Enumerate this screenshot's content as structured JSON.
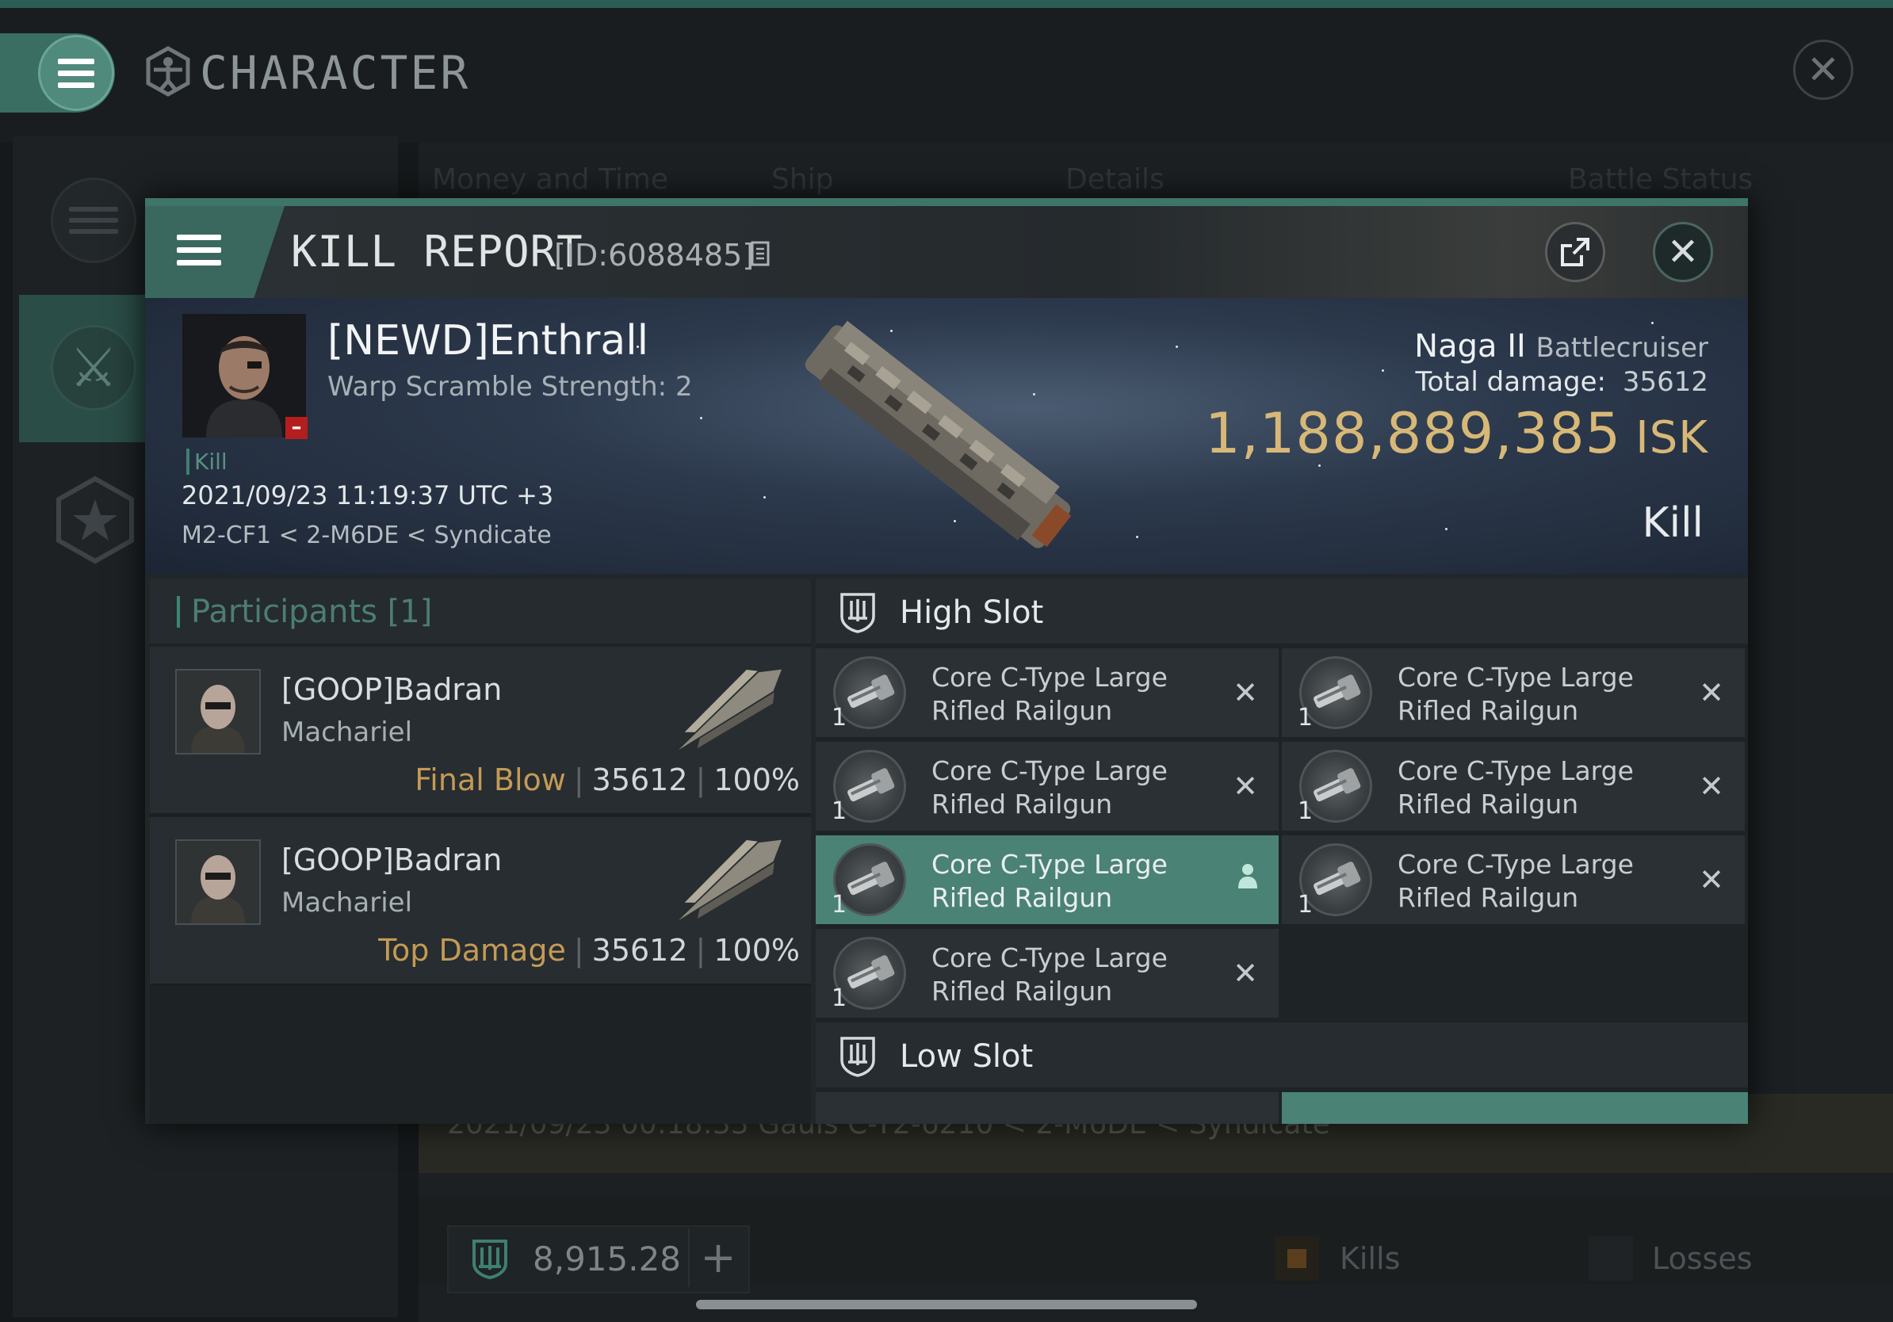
{
  "background": {
    "title": "CHARACTER",
    "columns": [
      "Money and Time",
      "Ship",
      "Details",
      "Battle Status"
    ],
    "partial_row_text": "2021/09/23 00:18:33  Gauls C-T2-6210 < 2-M6DE < Syndicate",
    "wallet": {
      "value": "8,915.28"
    },
    "filters": {
      "kills_label": "Kills",
      "losses_label": "Losses"
    }
  },
  "report": {
    "title": "KILL REPORT",
    "id": "[ID:6088485]",
    "victim": {
      "name": "[NEWD]Enthrall",
      "subtitle": "Warp Scramble Strength: 2",
      "tag": "Kill",
      "datetime": "2021/09/23 11:19:37 UTC +3",
      "location": "M2-CF1 < 2-M6DE < Syndicate"
    },
    "ship": {
      "name": "Naga II",
      "class": "Battlecruiser",
      "damage_label": "Total damage:",
      "damage": "35612",
      "isk_value": "1,188,889,385",
      "isk_unit": "ISK",
      "result": "Kill"
    },
    "participants": {
      "title": "Participants [1]",
      "rows": [
        {
          "name": "[GOOP]Badran",
          "ship": "Machariel",
          "tag": "Final Blow",
          "damage": "35612",
          "percent": "100%"
        },
        {
          "name": "[GOOP]Badran",
          "ship": "Machariel",
          "tag": "Top Damage",
          "damage": "35612",
          "percent": "100%"
        }
      ]
    },
    "high_slot": {
      "title": "High Slot",
      "modules": [
        {
          "qty": "1",
          "line1": "Core C-Type Large",
          "line2": "Rifled Railgun",
          "status": "destroyed"
        },
        {
          "qty": "1",
          "line1": "Core C-Type Large",
          "line2": "Rifled Railgun",
          "status": "destroyed"
        },
        {
          "qty": "1",
          "line1": "Core C-Type Large",
          "line2": "Rifled Railgun",
          "status": "destroyed"
        },
        {
          "qty": "1",
          "line1": "Core C-Type Large",
          "line2": "Rifled Railgun",
          "status": "destroyed"
        },
        {
          "qty": "1",
          "line1": "Core C-Type Large",
          "line2": "Rifled Railgun",
          "status": "dropped"
        },
        {
          "qty": "1",
          "line1": "Core C-Type Large",
          "line2": "Rifled Railgun",
          "status": "destroyed"
        },
        {
          "qty": "1",
          "line1": "Core C-Type Large",
          "line2": "Rifled Railgun",
          "status": "destroyed"
        }
      ],
      "destroyed_mark": "✕"
    },
    "low_slot": {
      "title": "Low Slot"
    },
    "colors": {
      "accent": "#3f7468",
      "isk": "#d8b877",
      "tag": "#c49a55",
      "selected": "#4a8275"
    }
  }
}
